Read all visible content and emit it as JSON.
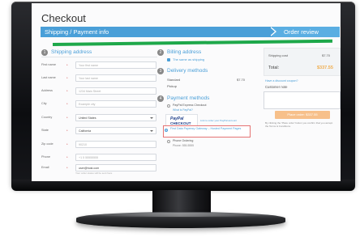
{
  "page": {
    "title": "Checkout",
    "steps": [
      "Shipping / Payment info",
      "Order review"
    ]
  },
  "colors": {
    "accent": "#4a9fd8",
    "highlight_line": "#1ea84a",
    "total": "#f0ad4e",
    "button": "#f7c08a"
  },
  "shipping": {
    "number": "1",
    "title": "Shipping address",
    "fields": [
      {
        "label": "First name",
        "value": "Your first name",
        "filled": false
      },
      {
        "label": "Last name",
        "value": "Your last name",
        "filled": false
      },
      {
        "label": "Address",
        "value": "1234 Main Street",
        "filled": false
      },
      {
        "label": "City",
        "value": "Example city",
        "filled": false
      },
      {
        "label": "Country",
        "value": "United States",
        "filled": true,
        "select": true
      },
      {
        "label": "State",
        "value": "California",
        "filled": true,
        "select": true
      },
      {
        "label": "Zip code",
        "value": "90210",
        "filled": false
      },
      {
        "label": "Phone",
        "value": "+1 5 55555555",
        "filled": false
      },
      {
        "label": "Email",
        "value": "user@host.com",
        "filled": true
      }
    ],
    "hint": "Your order status will be sent here"
  },
  "billing": {
    "number": "2",
    "title": "Billing address",
    "same_as_shipping": "The same as shipping"
  },
  "delivery": {
    "number": "3",
    "title": "Delivery methods",
    "options": [
      {
        "label": "Standard",
        "price": "$7.70"
      },
      {
        "label": "Pickup"
      }
    ]
  },
  "payment": {
    "number": "4",
    "title": "Payment methods",
    "options": [
      {
        "label": "PayPal Express Checkout",
        "link": "What is PayPal?"
      },
      {
        "label": "First Data Payeezy Gateway – Hosted Payment Pages",
        "selected": true
      },
      {
        "label": "Phone Ordering",
        "sub": "Phone: 555-5555"
      }
    ],
    "paypal": {
      "logo": "PayPal",
      "checkout": "CHECKOUT",
      "link": "Link to order your PayPal account"
    }
  },
  "summary": {
    "shipping_label": "Shipping cost",
    "shipping_value": "$7.70",
    "total_label": "Total:",
    "total_value": "$337.55",
    "discount_link": "Have a discount coupon?",
    "note_label": "Customer note",
    "place_order": "Place order: $337.55",
    "terms": "By clicking the 'Place order' button you confirm that you accept the Terms & Conditions."
  }
}
